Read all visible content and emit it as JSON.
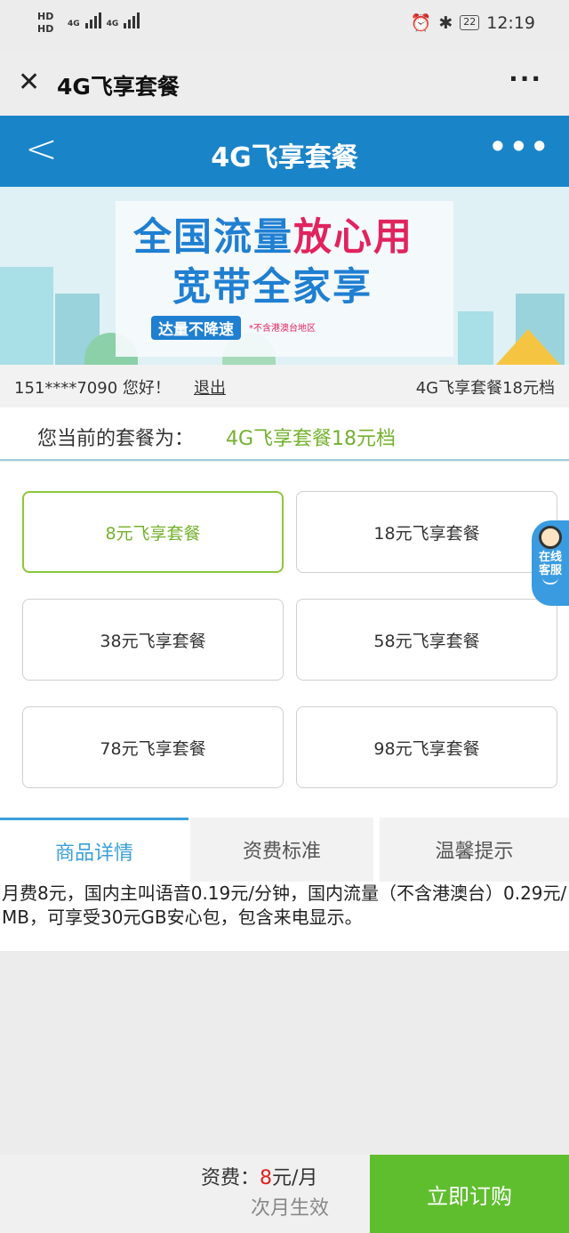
{
  "status_bar": {
    "hd1": "HD",
    "hd2": "HD",
    "net1": "4G",
    "net2": "4G",
    "battery": "22",
    "time": "12:19",
    "icons": [
      "alarm-icon",
      "bluetooth-icon",
      "battery-icon"
    ]
  },
  "wechat_nav": {
    "close_icon": "close-icon",
    "title": "4G飞享套餐",
    "more_icon": "more-icon"
  },
  "header": {
    "back_icon": "chevron-left-icon",
    "title": "4G飞享套餐",
    "more_icon": "more-icon",
    "color": "#1a84c9"
  },
  "banner": {
    "line1_part1": "全国流量",
    "line1_part2": "放心用",
    "line2": "宽带全家享",
    "badge": "达量不降速",
    "note": "*不含港澳台地区"
  },
  "user": {
    "phone_greeting": "151****7090  您好！",
    "logout": "退出",
    "plan": "4G飞享套餐18元档"
  },
  "current_plan": {
    "label": "您当前的套餐为：",
    "value": "4G飞享套餐18元档",
    "accent": "#74b12e"
  },
  "plans": [
    {
      "label": "8元飞享套餐",
      "selected": true
    },
    {
      "label": "18元飞享套餐",
      "selected": false
    },
    {
      "label": "38元飞享套餐",
      "selected": false
    },
    {
      "label": "58元飞享套餐",
      "selected": false
    },
    {
      "label": "78元飞享套餐",
      "selected": false
    },
    {
      "label": "98元飞享套餐",
      "selected": false
    }
  ],
  "service": {
    "line1": "在线",
    "line2": "客服"
  },
  "tabs": [
    {
      "label": "商品详情",
      "active": true
    },
    {
      "label": "资费标准",
      "active": false
    },
    {
      "label": "温馨提示",
      "active": false
    }
  ],
  "detail": {
    "text": "月费8元，国内主叫语音0.19元/分钟，国内流量（不含港澳台）0.29元/MB，可享受30元GB安心包，包含来电显示。"
  },
  "bottom": {
    "price_label": "资费：",
    "price_value": "8",
    "price_unit": "元/月",
    "effect": "次月生效",
    "buy": "立即订购",
    "buy_color": "#5fbe2e"
  }
}
